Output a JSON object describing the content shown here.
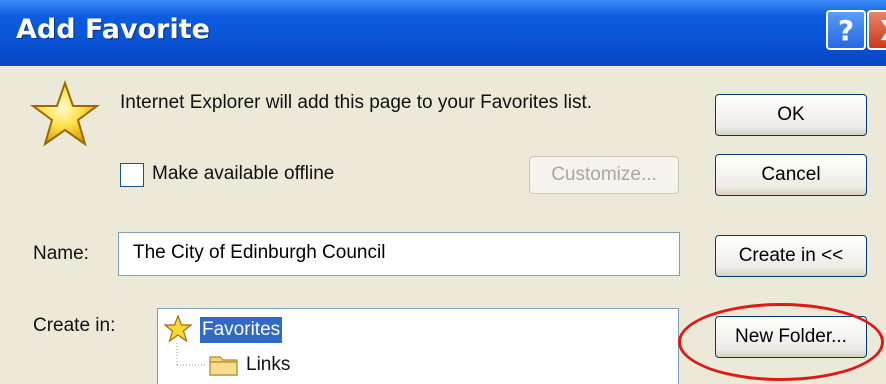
{
  "window": {
    "title": "Add Favorite",
    "help_label": "?",
    "close_label": "X"
  },
  "message": "Internet Explorer will add this page to your Favorites list.",
  "offline": {
    "label": "Make available offline",
    "checked": false
  },
  "buttons": {
    "customize": "Customize...",
    "ok": "OK",
    "cancel": "Cancel",
    "create_in": "Create in <<",
    "new_folder": "New Folder..."
  },
  "name_field": {
    "label": "Name:",
    "value": "The City of Edinburgh Council"
  },
  "create_in_label": "Create in:",
  "tree": {
    "items": [
      {
        "label": "Favorites",
        "icon": "star-icon",
        "selected": true
      },
      {
        "label": "Links",
        "icon": "folder-icon",
        "selected": false
      }
    ]
  },
  "colors": {
    "selection": "#316ac5",
    "highlight_oval": "#e01818",
    "title_bar": "#0a54d6"
  }
}
